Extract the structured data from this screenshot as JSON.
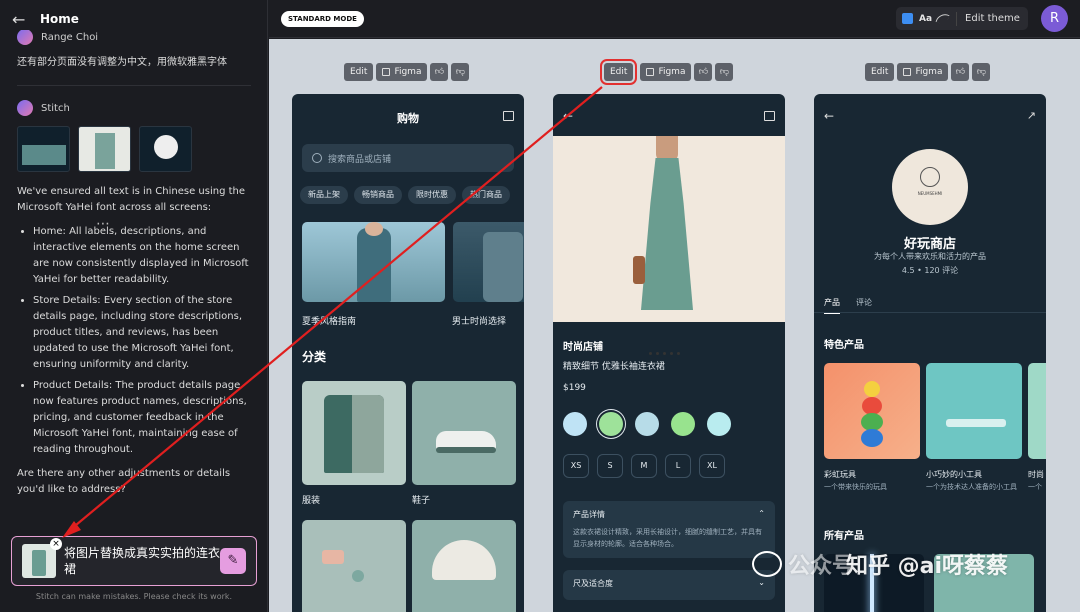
{
  "left_panel": {
    "title": "Home",
    "menu_glyph": "⋯",
    "user_name": "Range Choi",
    "user_message": "还有部分页面没有调整为中文，用微软雅黑字体",
    "assistant_name": "Stitch",
    "assistant_intro": "We've ensured all text is in Chinese using the Microsoft YaHei font across all screens:",
    "bullets": [
      "Home: All labels, descriptions, and interactive elements on the home screen are now consistently displayed in Microsoft YaHei for better readability.",
      "Store Details: Every section of the store details page, including store descriptions, product titles, and reviews, has been updated to use the Microsoft YaHei font, ensuring uniformity and clarity.",
      "Product Details: The product details page now features product names, descriptions, pricing, and customer feedback in the Microsoft YaHei font, maintaining ease of reading throughout."
    ],
    "assistant_outro": "Are there any other adjustments or details you'd like to address?",
    "compose_text": "将图片替换成真实实拍的连衣裙",
    "disclaimer": "Stitch can make mistakes. Please check its work."
  },
  "topbar": {
    "mode_badge": "STANDARD MODE",
    "theme_aa": "Aa",
    "edit_theme": "Edit theme",
    "user_initial": "R"
  },
  "toolbar": {
    "edit": "Edit",
    "figma": "Figma"
  },
  "screen_home": {
    "title": "购物",
    "search_placeholder": "搜索商品或店铺",
    "chips": [
      "新品上架",
      "畅销商品",
      "限时优惠",
      "热门商品"
    ],
    "featured": [
      "夏季风格指南",
      "男士时尚选择"
    ],
    "section_title": "分类",
    "categories": [
      "服装",
      "鞋子"
    ]
  },
  "screen_product": {
    "store": "时尚店铺",
    "name": "精致细节 优雅长袖连衣裙",
    "price": "$199",
    "swatch_colors": [
      "#bfe3f5",
      "#9ee29a",
      "#b7dce8",
      "#98e38e",
      "#b9ecef"
    ],
    "sizes": [
      "XS",
      "S",
      "M",
      "L",
      "XL"
    ],
    "details_title": "产品详情",
    "details_body": "这款衣裙设计精致，采用长袖设计，细腻的缝制工艺，并具有显示身材的轮廓。适合各种场合。",
    "size_fit_title": "尺及适合度"
  },
  "screen_store": {
    "logo_text": "NEUMSEHMI",
    "name": "好玩商店",
    "subtitle": "为每个人带来欢乐和活力的产品",
    "rating": "4.5 • 120 评论",
    "tabs": [
      "产品",
      "评论"
    ],
    "featured_title": "特色产品",
    "products": [
      {
        "name": "彩虹玩具",
        "desc": "一个带来快乐的玩具"
      },
      {
        "name": "小巧妙的小工具",
        "desc": "一个为技术达人准备的小工具"
      },
      {
        "name": "时尚",
        "desc": "一个"
      }
    ],
    "all_products_title": "所有产品"
  },
  "watermark": "知乎 @ai呀蔡蔡",
  "watermark_prefix": "公众号"
}
